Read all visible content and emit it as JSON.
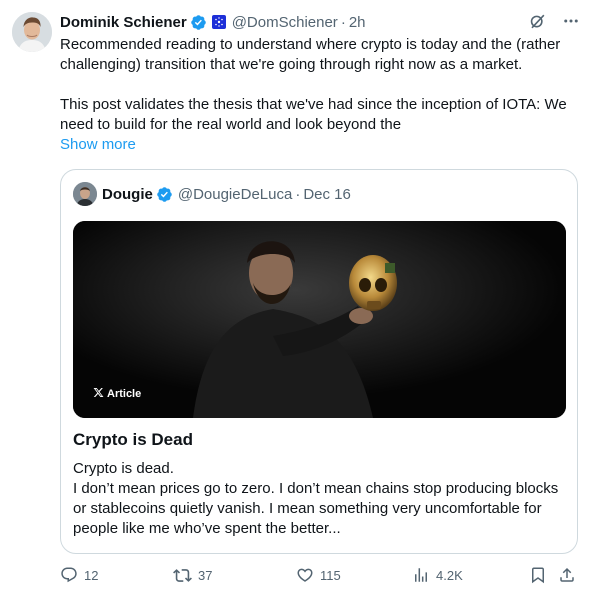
{
  "author": {
    "name": "Dominik Schiener",
    "handle": "@DomSchiener",
    "separator": "·",
    "time": "2h"
  },
  "post": {
    "paragraph1": "Recommended reading to understand where crypto is today and the (rather challenging) transition that we're going through right now as a market.",
    "paragraph2": "This post validates the thesis that we've had since the inception of IOTA: We need to build for the real world and look beyond the",
    "show_more": "Show more"
  },
  "quote": {
    "name": "Dougie",
    "handle": "@DougieDeLuca",
    "separator": "·",
    "date": "Dec 16",
    "article_tag": "Article",
    "title": "Crypto is Dead",
    "body_line1": "Crypto is dead.",
    "body_line2": "I don’t mean prices go to zero. I don’t mean chains stop producing blocks or stablecoins quietly vanish. I mean something very uncomfortable for people like me who’ve spent the better..."
  },
  "actions": {
    "replies": "12",
    "reposts": "37",
    "likes": "115",
    "views": "4.2K"
  },
  "icons": {
    "verified": "verified-badge-icon",
    "affiliate": "iota-affiliate-icon",
    "grok": "grok-icon",
    "more": "more-icon",
    "x_logo": "x-logo-icon",
    "reply": "reply-icon",
    "repost": "repost-icon",
    "like": "heart-icon",
    "views": "views-icon",
    "bookmark": "bookmark-icon",
    "share": "share-icon"
  },
  "colors": {
    "link": "#1d9bf0",
    "secondary_text": "#536471",
    "verified": "#1d9bf0",
    "affiliate_badge": "#1d2fd8"
  }
}
